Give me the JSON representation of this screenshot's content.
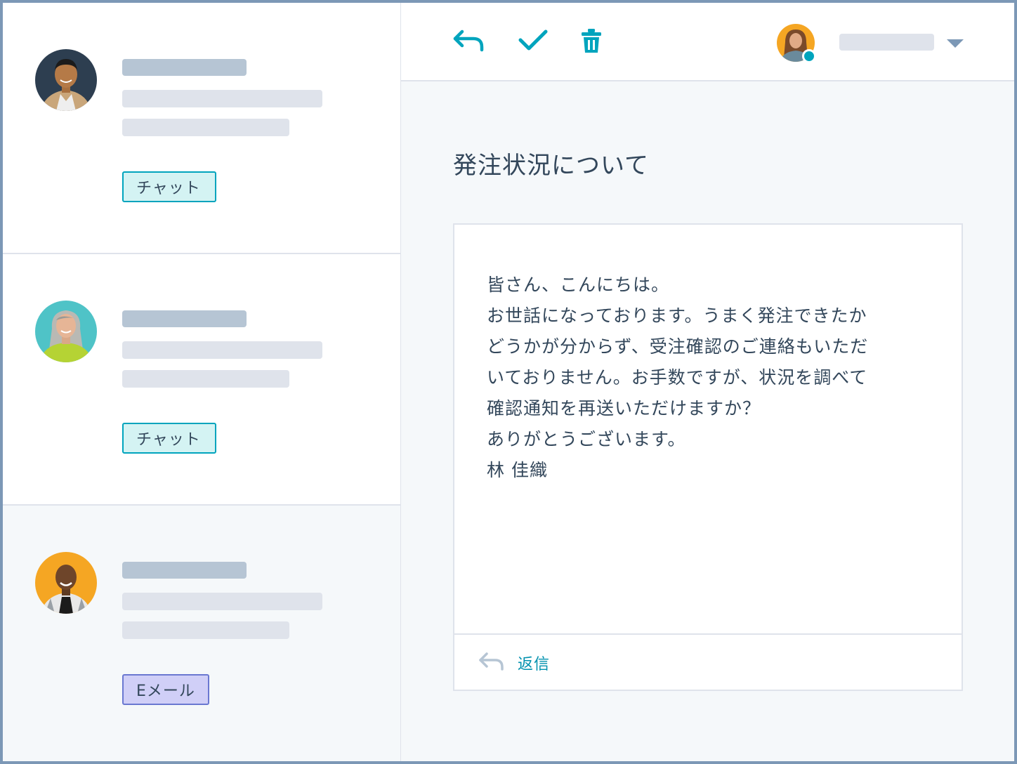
{
  "conversations": [
    {
      "channel_tag": "チャット",
      "tag_kind": "chat",
      "avatar_bg": "#2d3e50"
    },
    {
      "channel_tag": "チャット",
      "tag_kind": "chat",
      "avatar_bg": "#4fc3c7"
    },
    {
      "channel_tag": "Eメール",
      "tag_kind": "email",
      "avatar_bg": "#f5a623"
    }
  ],
  "toolbar": {
    "icons": [
      "reply-icon",
      "check-icon",
      "trash-icon",
      "chevron-down-icon"
    ]
  },
  "message": {
    "subject": "発注状況について",
    "body_lines": [
      "皆さん、こんにちは。",
      "お世話になっております。うまく発注できたか",
      "どうかが分からず、受注確認のご連絡もいただ",
      "いておりません。お手数ですが、状況を調べて",
      "確認通知を再送いただけますか？",
      "ありがとうございます。",
      "林 佳織"
    ],
    "reply_label": "返信"
  },
  "colors": {
    "accent": "#00a4bd",
    "link": "#0091ae",
    "chat_tag_bg": "#d4f3f3",
    "email_tag_bg": "#d0cff7",
    "placeholder_dark": "#b6c5d4",
    "placeholder_light": "#dfe3eb"
  }
}
